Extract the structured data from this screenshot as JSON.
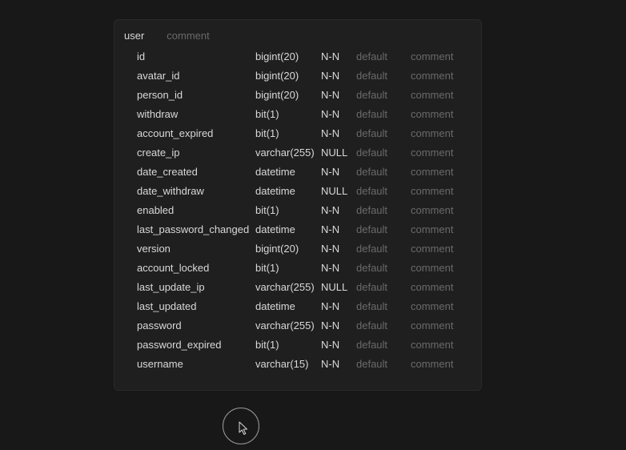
{
  "table": {
    "name": "user",
    "comment": "comment"
  },
  "labels": {
    "default": "default",
    "comment": "comment"
  },
  "columns": [
    {
      "name": "id",
      "type": "bigint(20)",
      "null": "N-N"
    },
    {
      "name": "avatar_id",
      "type": "bigint(20)",
      "null": "N-N"
    },
    {
      "name": "person_id",
      "type": "bigint(20)",
      "null": "N-N"
    },
    {
      "name": "withdraw",
      "type": "bit(1)",
      "null": "N-N"
    },
    {
      "name": "account_expired",
      "type": "bit(1)",
      "null": "N-N"
    },
    {
      "name": "create_ip",
      "type": "varchar(255)",
      "null": "NULL"
    },
    {
      "name": "date_created",
      "type": "datetime",
      "null": "N-N"
    },
    {
      "name": "date_withdraw",
      "type": "datetime",
      "null": "NULL"
    },
    {
      "name": "enabled",
      "type": "bit(1)",
      "null": "N-N"
    },
    {
      "name": "last_password_changed",
      "type": "datetime",
      "null": "N-N"
    },
    {
      "name": "version",
      "type": "bigint(20)",
      "null": "N-N"
    },
    {
      "name": "account_locked",
      "type": "bit(1)",
      "null": "N-N"
    },
    {
      "name": "last_update_ip",
      "type": "varchar(255)",
      "null": "NULL"
    },
    {
      "name": "last_updated",
      "type": "datetime",
      "null": "N-N"
    },
    {
      "name": "password",
      "type": "varchar(255)",
      "null": "N-N"
    },
    {
      "name": "password_expired",
      "type": "bit(1)",
      "null": "N-N"
    },
    {
      "name": "username",
      "type": "varchar(15)",
      "null": "N-N"
    }
  ]
}
